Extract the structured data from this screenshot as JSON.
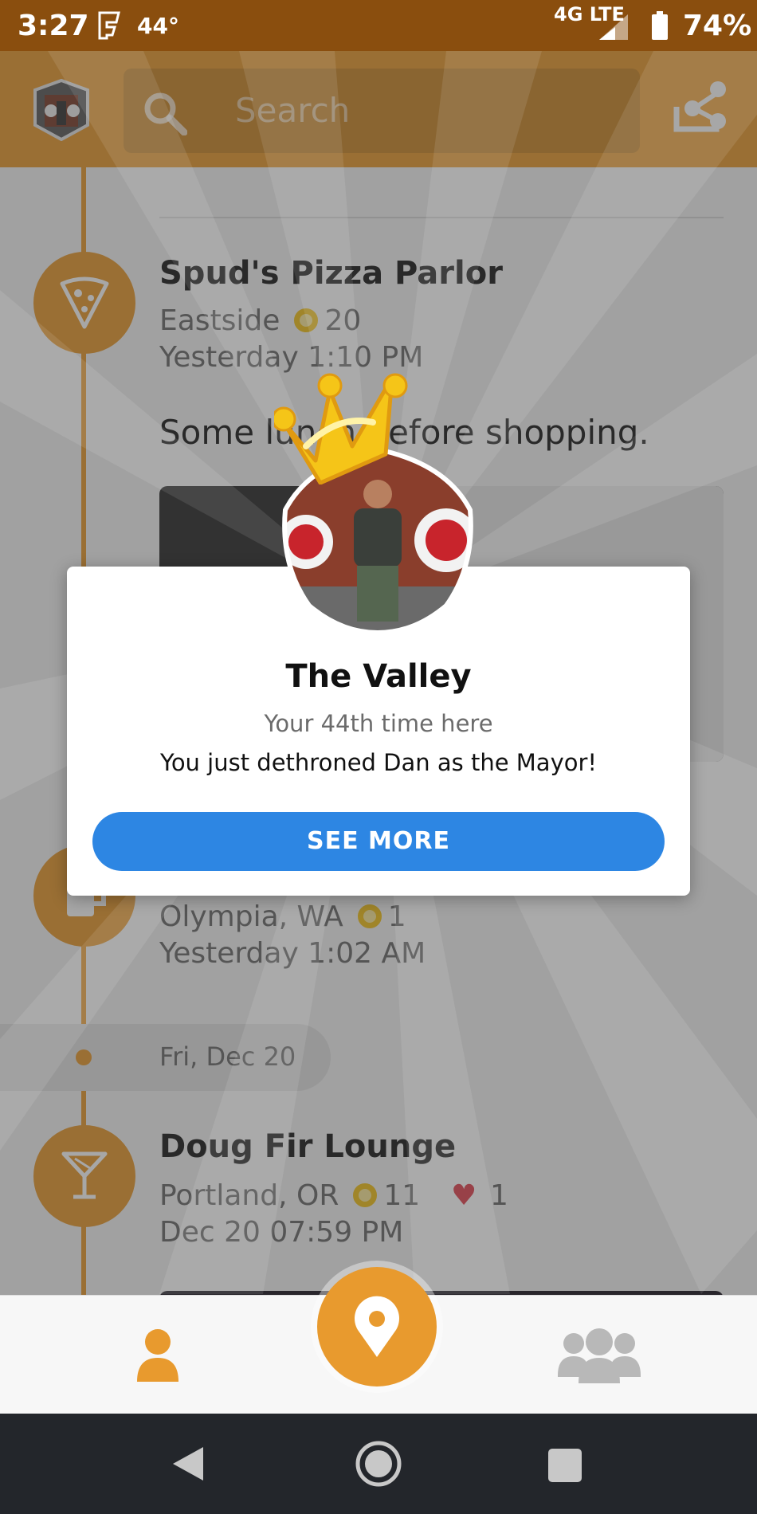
{
  "status_bar": {
    "time": "3:27",
    "temperature": "44°",
    "network": "4G LTE",
    "battery": "74%"
  },
  "header": {
    "search_placeholder": "Search",
    "icons": [
      "avatar-badge",
      "search-icon",
      "share-icon"
    ]
  },
  "feed": {
    "checkins": [
      {
        "name": "Spud's Pizza Parlor",
        "location": "Eastside",
        "coins": "20",
        "time": "Yesterday 1:10 PM",
        "shout": "Some lunch before shopping.",
        "category_icon": "pizza-icon"
      },
      {
        "name": "",
        "location": "Olympia, WA",
        "coins": "1",
        "time": "Yesterday 1:02 AM",
        "category_icon": "beer-icon"
      },
      {
        "name": "Doug Fir Lounge",
        "location": "Portland, OR",
        "coins": "11",
        "likes": "1",
        "time": "Dec 20 07:59 PM",
        "category_icon": "cocktail-icon"
      }
    ],
    "date_separator": "Fri, Dec 20"
  },
  "modal": {
    "title": "The Valley",
    "subtitle": "Your 44th time here",
    "message": "You just dethroned Dan as the Mayor!",
    "button_label": "SEE MORE"
  },
  "tab_bar": {
    "icons": [
      "profile-icon",
      "location-pin-icon",
      "friends-icon"
    ]
  },
  "colors": {
    "brand_orange": "#e89a2e",
    "status_brown": "#8a4e0e",
    "button_blue": "#2d86e3",
    "crown_gold": "#f5c518"
  }
}
